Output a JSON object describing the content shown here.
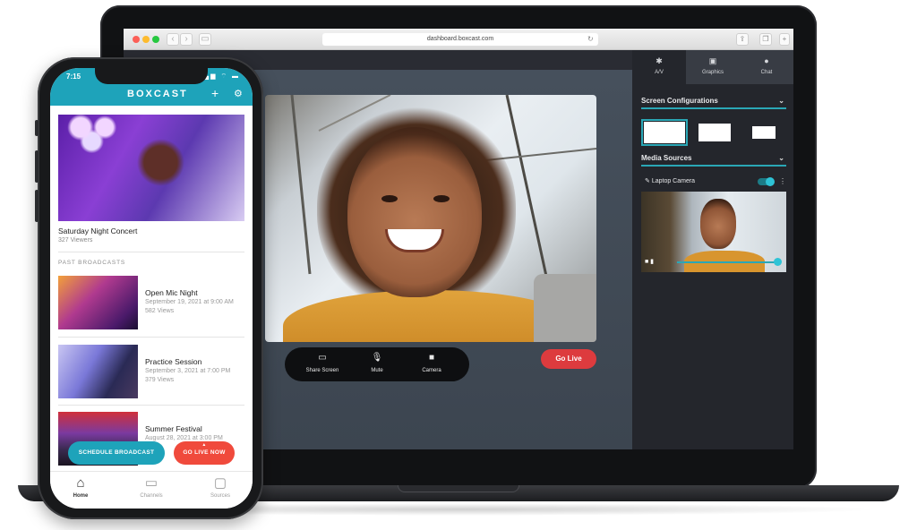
{
  "browser": {
    "url": "dashboard.boxcast.com"
  },
  "dashboard": {
    "controls": [
      {
        "icon": "monitor-icon",
        "label": "Share Screen"
      },
      {
        "icon": "microphone-icon",
        "label": "Mute"
      },
      {
        "icon": "camera-icon",
        "label": "Camera"
      }
    ],
    "go_live_label": "Go Live",
    "side_panel": {
      "tabs": [
        {
          "icon": "gear-icon",
          "label": "A/V",
          "active": true
        },
        {
          "icon": "image-icon",
          "label": "Graphics",
          "active": false
        },
        {
          "icon": "chat-icon",
          "label": "Chat",
          "active": false
        }
      ],
      "screen_configurations_label": "Screen Configurations",
      "media_sources_label": "Media Sources",
      "source_name": "Laptop Camera",
      "source_enabled": true
    }
  },
  "phone": {
    "time": "7:15",
    "brand": "BOXCAST",
    "featured": {
      "title": "Saturday Night Concert",
      "viewers": "327 Viewers"
    },
    "past_broadcasts_label": "PAST BROADCASTS",
    "broadcasts": [
      {
        "title": "Open Mic Night",
        "date": "September 19, 2021 at 9:00 AM",
        "views": "582 Views"
      },
      {
        "title": "Practice Session",
        "date": "September 3, 2021 at 7:00 PM",
        "views": "379 Views"
      },
      {
        "title": "Summer Festival",
        "date": "August 28, 2021 at 3:00 PM",
        "views": ""
      }
    ],
    "schedule_button": "SCHEDULE BROADCAST",
    "go_live_now_button": "GO LIVE NOW",
    "tabbar": [
      {
        "icon": "home-icon",
        "label": "Home",
        "active": true
      },
      {
        "icon": "tv-icon",
        "label": "Channels",
        "active": false
      },
      {
        "icon": "video-camera-icon",
        "label": "Sources",
        "active": false
      }
    ]
  },
  "colors": {
    "brand_teal": "#1ea3ba",
    "live_red": "#dd3b3e",
    "go_live_now_red": "#f04a3c"
  }
}
